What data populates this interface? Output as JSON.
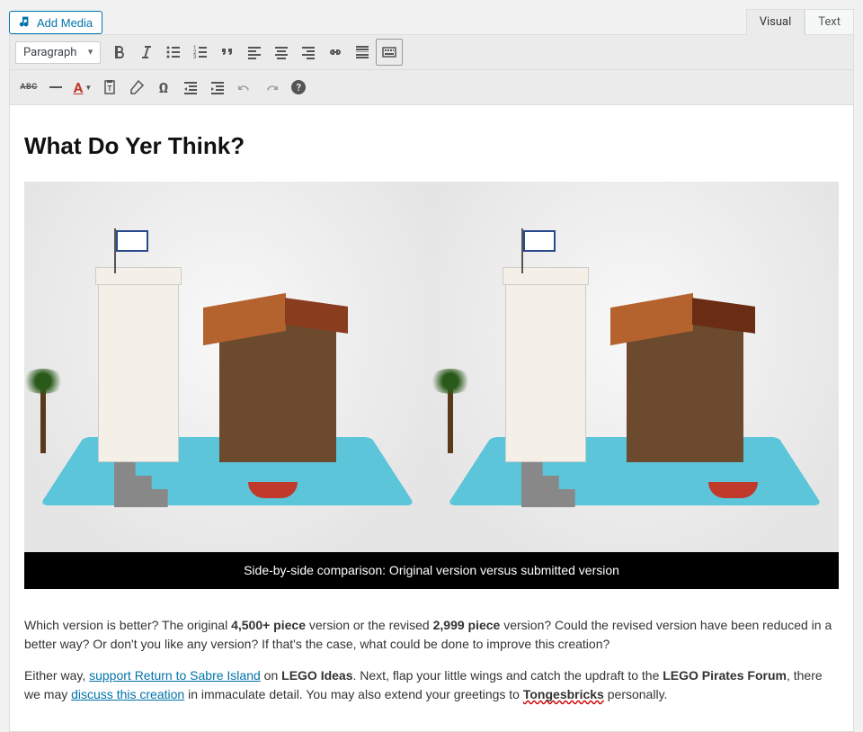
{
  "buttons": {
    "add_media": "Add Media"
  },
  "tabs": {
    "visual": "Visual",
    "text": "Text"
  },
  "toolbar": {
    "format_dropdown": "Paragraph",
    "abc": "ABC"
  },
  "content": {
    "heading": "What Do Yer Think?",
    "caption": "Side-by-side comparison: Original version versus submitted version",
    "p1_part1": "Which version is better? The original ",
    "p1_bold1": "4,500+ piece",
    "p1_part2": " version or the revised ",
    "p1_bold2": "2,999 piece",
    "p1_part3": " version? Could the revised version have been reduced in a better way? Or don't you like any version? If that's the case, what could be done to improve this creation?",
    "p2_part1": "Either way, ",
    "p2_link1": "support Return to Sabre Island",
    "p2_part2": " on ",
    "p2_bold1": "LEGO Ideas",
    "p2_part3": ". Next, flap your little wings and catch the updraft to the ",
    "p2_bold2": "LEGO Pirates Forum",
    "p2_part4": ", there we may ",
    "p2_link2": "discuss this creation",
    "p2_part5": " in immaculate detail. You may also extend your greetings to ",
    "p2_squiggle": "Tongesbricks",
    "p2_part6": " personally."
  }
}
